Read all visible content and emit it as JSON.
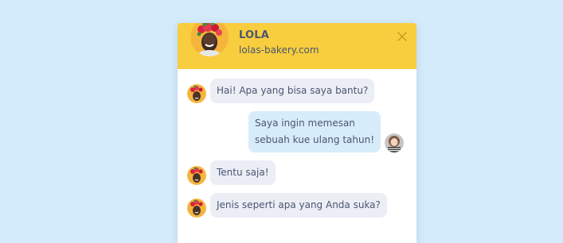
{
  "header": {
    "agent_name": "LOLA",
    "agent_site": "lolas-bakery.com"
  },
  "colors": {
    "page_background": "#d4ebfb",
    "header_background": "#f8cd3e",
    "incoming_bubble": "#eceef6",
    "outgoing_bubble": "#d7ecfb",
    "text": "#4a5670"
  },
  "icons": {
    "close": "close-icon",
    "agent_avatar": "agent-avatar-icon",
    "user_avatar": "user-avatar-icon"
  },
  "messages": [
    {
      "sender": "agent",
      "text": "Hai! Apa yang bisa saya bantu?"
    },
    {
      "sender": "user",
      "line1": "Saya ingin memesan",
      "line2": "sebuah kue ulang tahun!"
    },
    {
      "sender": "agent",
      "text": "Tentu saja!"
    },
    {
      "sender": "agent",
      "text": "Jenis seperti apa yang Anda suka?"
    }
  ]
}
